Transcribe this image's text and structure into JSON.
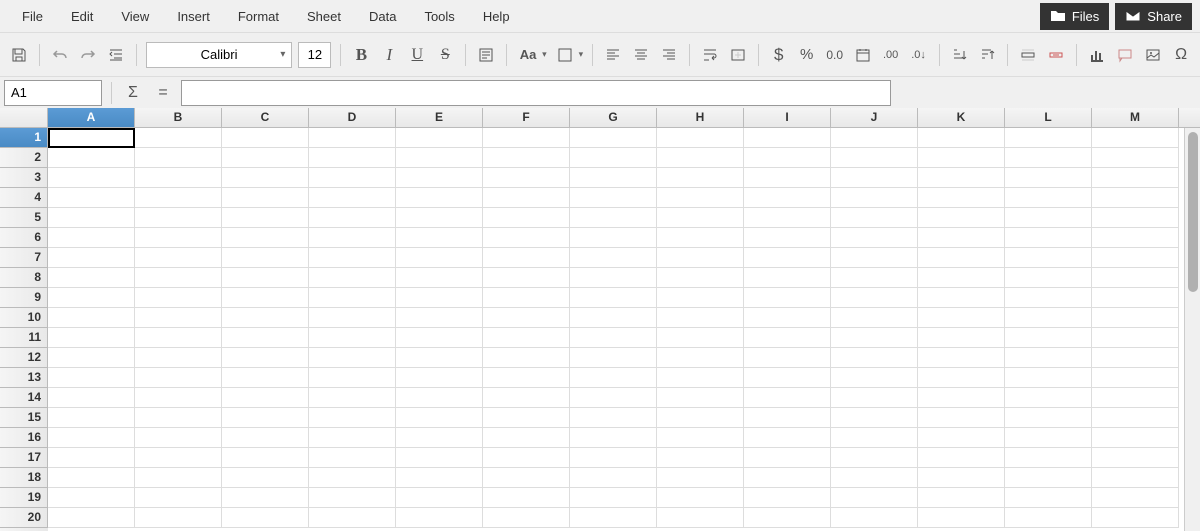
{
  "menu": {
    "items": [
      "File",
      "Edit",
      "View",
      "Insert",
      "Format",
      "Sheet",
      "Data",
      "Tools",
      "Help"
    ]
  },
  "topButtons": {
    "files": "Files",
    "share": "Share"
  },
  "toolbar": {
    "fontName": "Calibri",
    "fontSize": "12"
  },
  "formulaBar": {
    "nameBox": "A1",
    "formula": ""
  },
  "grid": {
    "columns": [
      "A",
      "B",
      "C",
      "D",
      "E",
      "F",
      "G",
      "H",
      "I",
      "J",
      "K",
      "L",
      "M"
    ],
    "rows": [
      "1",
      "2",
      "3",
      "4",
      "5",
      "6",
      "7",
      "8",
      "9",
      "10",
      "11",
      "12",
      "13",
      "14",
      "15",
      "16",
      "17",
      "18",
      "19",
      "20"
    ],
    "selectedCell": "A1",
    "selectedCol": 0,
    "selectedRow": 0
  }
}
